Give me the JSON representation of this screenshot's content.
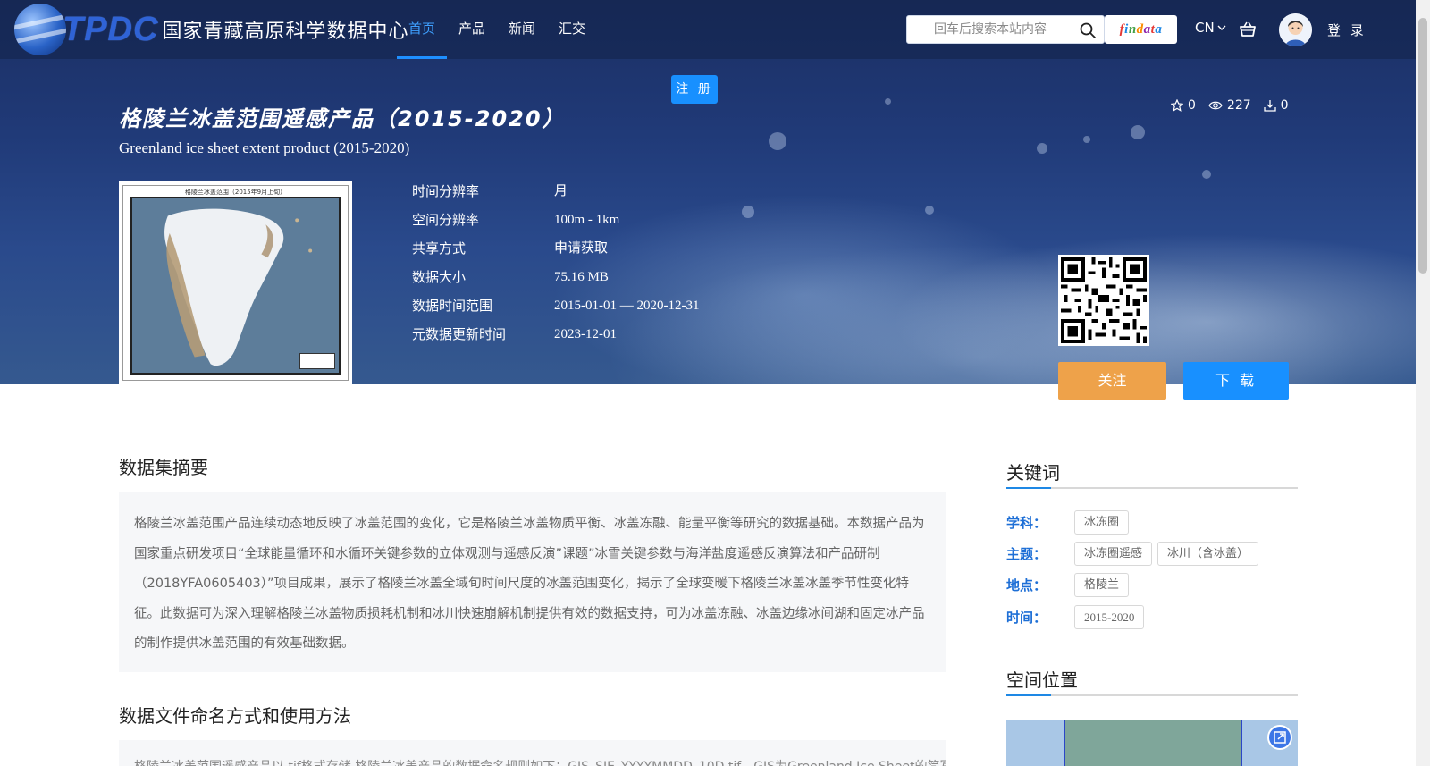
{
  "brand": {
    "logo_text": "TPDC",
    "logo_name": "国家青藏高原科学数据中心"
  },
  "nav": {
    "items": [
      {
        "label": "首页",
        "active": true
      },
      {
        "label": "产品",
        "active": false
      },
      {
        "label": "新闻",
        "active": false
      },
      {
        "label": "汇交",
        "active": false
      }
    ]
  },
  "header": {
    "search_placeholder": "回车后搜索本站内容",
    "findata_label": "findata",
    "lang": "CN",
    "login_label": "登 录",
    "register_label": "注 册"
  },
  "dataset": {
    "title_cn": "格陵兰冰盖范围遥感产品（2015-2020）",
    "title_en": "Greenland ice sheet extent product (2015-2020)",
    "stats": {
      "stars": "0",
      "views": "227",
      "downloads": "0"
    },
    "thumbnail_caption": "格陵兰冰盖范围（2015年9月上旬）",
    "meta": [
      {
        "label": "时间分辨率",
        "value": "月"
      },
      {
        "label": "空间分辨率",
        "value": "100m - 1km"
      },
      {
        "label": "共享方式",
        "value": "申请获取"
      },
      {
        "label": "数据大小",
        "value": "75.16 MB"
      },
      {
        "label": "数据时间范围",
        "value": "2015-01-01 — 2020-12-31"
      },
      {
        "label": "元数据更新时间",
        "value": "2023-12-01"
      }
    ],
    "follow_label": "关注",
    "download_label": "下 载"
  },
  "sections": {
    "abstract_title": "数据集摘要",
    "abstract_text": "格陵兰冰盖范围产品连续动态地反映了冰盖范围的变化，它是格陵兰冰盖物质平衡、冰盖冻融、能量平衡等研究的数据基础。本数据产品为国家重点研发项目“全球能量循环和水循环关键参数的立体观测与遥感反演”课题”冰雪关键参数与海洋盐度遥感反演算法和产品研制（2018YFA0605403）”项目成果，展示了格陵兰冰盖全域旬时间尺度的冰盖范围变化，揭示了全球变暖下格陵兰冰盖冰盖季节性变化特征。此数据可为深入理解格陵兰冰盖物质损耗机制和冰川快速崩解机制提供有效的数据支持，可为冰盖冻融、冰盖边缘冰间湖和固定冰产品的制作提供冰盖范围的有效基础数据。",
    "naming_title": "数据文件命名方式和使用方法",
    "naming_text": "格陵兰冰盖范围遥感产品以.tif格式存储,格陵兰冰盖产品的数据命名规则如下：GIS_SIE_YYYYMMDD_10D.tif，GIS为Greenland Ice Sheet的简写"
  },
  "sidebar": {
    "keywords_title": "关键词",
    "keyword_groups": [
      {
        "label": "学科：",
        "tags": [
          "冰冻圈"
        ]
      },
      {
        "label": "主题：",
        "tags": [
          "冰冻圈遥感",
          "冰川（含冰盖）"
        ]
      },
      {
        "label": "地点：",
        "tags": [
          "格陵兰"
        ]
      },
      {
        "label": "时间：",
        "tags": [
          "2015-2020"
        ]
      }
    ],
    "location_title": "空间位置"
  }
}
